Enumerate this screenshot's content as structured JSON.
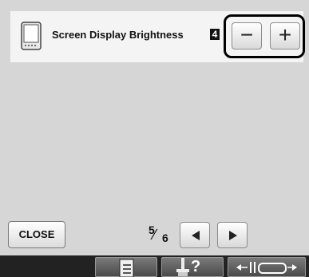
{
  "setting": {
    "label": "Screen Display Brightness",
    "value": "4",
    "icon": "device-icon"
  },
  "stepper": {
    "minus_label": "−",
    "plus_label": "+"
  },
  "footer": {
    "close_label": "CLOSE",
    "page_current": "5",
    "page_total": "6",
    "icons": [
      "checklist-icon",
      "help-icon",
      "presser-foot-adjust-icon"
    ]
  }
}
